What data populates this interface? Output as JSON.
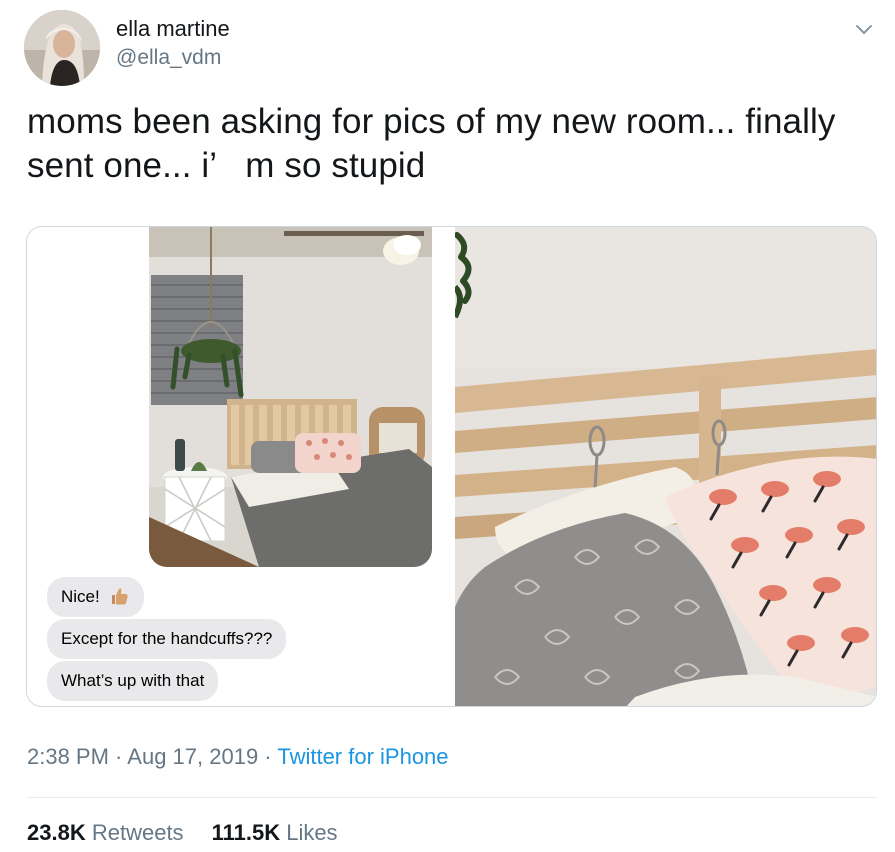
{
  "user": {
    "display_name": "ella martine",
    "handle": "@ella_vdm"
  },
  "tweet": {
    "text_line1": "moms been asking for pics of my new room... finally",
    "text_line2": "sent one... i’   m so stupid"
  },
  "messages": [
    {
      "text": "Nice! ",
      "emoji": "thumbs-up-icon"
    },
    {
      "text": "Except for the handcuffs???"
    },
    {
      "text": "What’s up with that"
    }
  ],
  "meta": {
    "time": "2:38 PM",
    "sep1": " · ",
    "date": "Aug 17, 2019",
    "sep2": " · ",
    "source": "Twitter for iPhone"
  },
  "stats": {
    "retweets_count": "23.8K",
    "retweets_label": "Retweets",
    "likes_count": "111.5K",
    "likes_label": "Likes"
  },
  "colors": {
    "text_primary": "#14171a",
    "text_secondary": "#657786",
    "link": "#1b95e0",
    "bubble": "#e9e9eb",
    "border": "#ccd6dd"
  }
}
